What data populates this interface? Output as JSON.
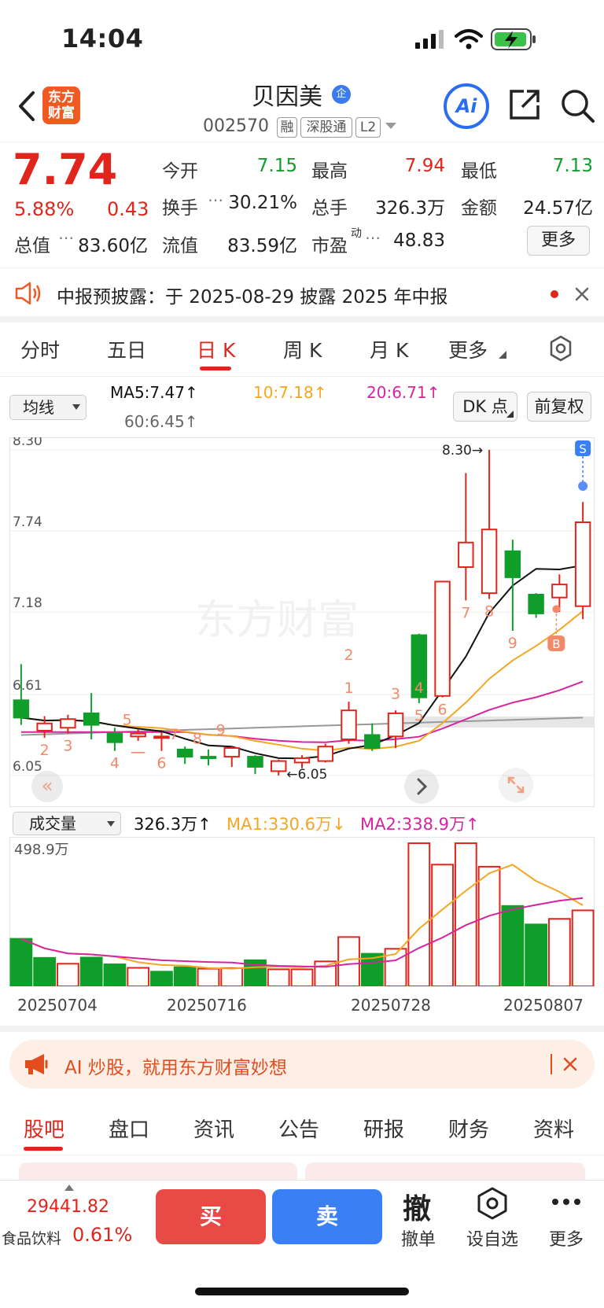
{
  "status_bar": {
    "time": "14:04"
  },
  "header": {
    "logo_text": "东方\n财富",
    "stock_name": "贝因美",
    "qi_badge": "企",
    "stock_code": "002570",
    "tags": [
      "融",
      "深股通",
      "L2"
    ]
  },
  "quote": {
    "price": "7.74",
    "change_pct": "5.88%",
    "change_amt": "0.43",
    "fields": [
      {
        "label": "今开",
        "value": "7.15",
        "color": "green"
      },
      {
        "label": "最高",
        "value": "7.94",
        "color": "red"
      },
      {
        "label": "最低",
        "value": "7.13",
        "color": "green"
      },
      {
        "label": "换手",
        "value": "30.21%",
        "color": "black"
      },
      {
        "label": "总手",
        "value": "326.3万",
        "color": "black"
      },
      {
        "label": "金额",
        "value": "24.57亿",
        "color": "black"
      },
      {
        "label": "总值",
        "value": "83.60亿",
        "color": "black"
      },
      {
        "label": "流值",
        "value": "83.59亿",
        "color": "black"
      },
      {
        "label": "市盈",
        "value": "48.83",
        "color": "black"
      }
    ],
    "pe_superscript": "动",
    "more_button": "更多"
  },
  "notice": {
    "text": "中报预披露：于 2025-08-29 披露 2025 年中报"
  },
  "chart_tabs": [
    "分时",
    "五日",
    "日 K",
    "周 K",
    "月 K",
    "更多"
  ],
  "ma_bar": {
    "selector": "均线",
    "ma5": "MA5:7.47",
    "ma10": "10:7.18",
    "ma20": "20:6.71",
    "ma60": "60:6.45",
    "dk_button": "DK 点",
    "adjust_button": "前复权"
  },
  "chart_data": {
    "type": "candlestick",
    "y_ticks": [
      "8.30",
      "7.74",
      "7.18",
      "6.61",
      "6.05"
    ],
    "ylim": [
      6.05,
      8.3
    ],
    "high_marker": "8.30",
    "low_marker": "6.05",
    "watermark": "东方财富",
    "candles": [
      {
        "o": 6.57,
        "c": 6.45,
        "h": 6.82,
        "l": 6.4,
        "n": ""
      },
      {
        "o": 6.36,
        "c": 6.41,
        "h": 6.46,
        "l": 6.31,
        "n": "2"
      },
      {
        "o": 6.38,
        "c": 6.44,
        "h": 6.47,
        "l": 6.34,
        "n": "3"
      },
      {
        "o": 6.48,
        "c": 6.4,
        "h": 6.62,
        "l": 6.3,
        "n": ""
      },
      {
        "o": 6.34,
        "c": 6.28,
        "h": 6.38,
        "l": 6.22,
        "n": "4"
      },
      {
        "o": 6.32,
        "c": 6.34,
        "h": 6.37,
        "l": 6.29,
        "n": "一"
      },
      {
        "o": 6.31,
        "c": 6.32,
        "h": 6.35,
        "l": 6.22,
        "n": "6"
      },
      {
        "o": 6.23,
        "c": 6.18,
        "h": 6.25,
        "l": 6.13,
        "n": ""
      },
      {
        "o": 6.18,
        "c": 6.17,
        "h": 6.23,
        "l": 6.12,
        "n": ""
      },
      {
        "o": 6.18,
        "c": 6.24,
        "h": 6.25,
        "l": 6.11,
        "n": ""
      },
      {
        "o": 6.18,
        "c": 6.11,
        "h": 6.19,
        "l": 6.06,
        "n": ""
      },
      {
        "o": 6.08,
        "c": 6.15,
        "h": 6.16,
        "l": 6.05,
        "n": ""
      },
      {
        "o": 6.14,
        "c": 6.17,
        "h": 6.19,
        "l": 6.1,
        "n": ""
      },
      {
        "o": 6.15,
        "c": 6.25,
        "h": 6.27,
        "l": 6.14,
        "n": ""
      },
      {
        "o": 6.3,
        "c": 6.5,
        "h": 6.56,
        "l": 6.27,
        "n": ""
      },
      {
        "o": 6.33,
        "c": 6.24,
        "h": 6.41,
        "l": 6.22,
        "n": ""
      },
      {
        "o": 6.32,
        "c": 6.48,
        "h": 6.5,
        "l": 6.24,
        "n": ""
      },
      {
        "o": 7.02,
        "c": 6.59,
        "h": 7.03,
        "l": 6.55,
        "n": "5"
      },
      {
        "o": 6.6,
        "c": 7.39,
        "h": 7.39,
        "l": 6.59,
        "n": "6"
      },
      {
        "o": 7.49,
        "c": 7.66,
        "h": 8.14,
        "l": 7.26,
        "n": "7"
      },
      {
        "o": 7.31,
        "c": 7.75,
        "h": 8.3,
        "l": 7.27,
        "n": "8"
      },
      {
        "o": 7.6,
        "c": 7.42,
        "h": 7.68,
        "l": 7.05,
        "n": "9"
      },
      {
        "o": 7.3,
        "c": 7.17,
        "h": 7.31,
        "l": 7.14,
        "n": ""
      },
      {
        "o": 7.28,
        "c": 7.37,
        "h": 7.44,
        "l": 7.18,
        "n": ""
      },
      {
        "o": 7.22,
        "c": 7.8,
        "h": 7.94,
        "l": 7.13,
        "n": ""
      }
    ],
    "extra_labels": [
      "5",
      "7",
      "8",
      "9",
      "1",
      "2",
      "3",
      "4"
    ],
    "signals": {
      "buy": "B",
      "sell": "S"
    }
  },
  "volume": {
    "selector": "成交量",
    "current": "326.3万",
    "ma1": "MA1:330.6万",
    "ma2": "MA2:338.9万",
    "max_label": "498.9万",
    "dates": [
      "20250704",
      "20250716",
      "20250728",
      "20250807"
    ],
    "values": [
      162,
      97,
      77,
      98,
      75,
      63,
      50,
      65,
      60,
      62,
      89,
      58,
      58,
      85,
      168,
      111,
      128,
      488,
      415,
      488,
      408,
      274,
      211,
      230,
      259
    ],
    "up": [
      false,
      false,
      true,
      false,
      false,
      true,
      false,
      false,
      true,
      true,
      false,
      true,
      true,
      true,
      true,
      false,
      true,
      true,
      true,
      true,
      true,
      false,
      false,
      true,
      true
    ]
  },
  "ad": {
    "text": "AI 炒股，就用东方财富妙想"
  },
  "bottom_tabs": [
    "股吧",
    "盘口",
    "资讯",
    "公告",
    "研报",
    "财务",
    "资料"
  ],
  "bottom_bar": {
    "index_value": "29441.82",
    "sector_name": "食品饮料",
    "sector_pct": "0.61%",
    "buy": "买",
    "sell": "卖",
    "cancel_icon": "撤",
    "cancel": "撤单",
    "watchlist": "设自选",
    "more": "更多"
  }
}
